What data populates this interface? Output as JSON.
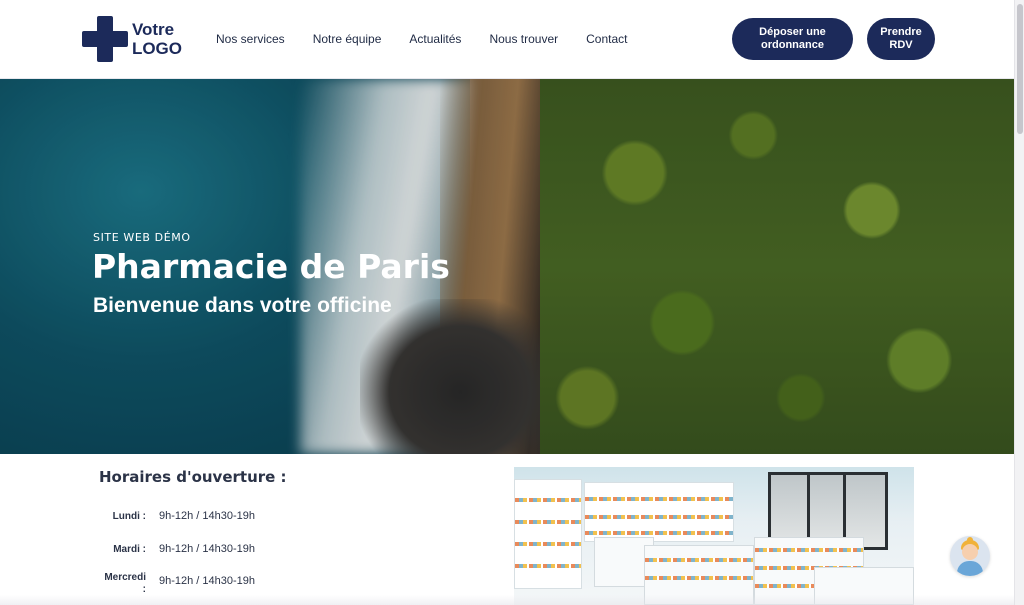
{
  "header": {
    "logo": {
      "line1": "Votre",
      "line2": "LOGO"
    },
    "nav": [
      {
        "label": "Nos services"
      },
      {
        "label": "Notre équipe"
      },
      {
        "label": "Actualités"
      },
      {
        "label": "Nous trouver"
      },
      {
        "label": "Contact"
      }
    ],
    "buttons": {
      "ordonnance": "Déposer une ordonnance",
      "rdv": "Prendre RDV"
    }
  },
  "hero": {
    "kicker": "SITE WEB DÉMO",
    "title": "Pharmacie de Paris",
    "subtitle": "Bienvenue dans votre officine"
  },
  "hours": {
    "title": "Horaires d'ouverture :",
    "rows": [
      {
        "day": "Lundi :",
        "value": "9h-12h / 14h30-19h"
      },
      {
        "day": "Mardi :",
        "value": "9h-12h / 14h30-19h"
      },
      {
        "day": "Mercredi :",
        "value": "9h-12h / 14h30-19h"
      }
    ]
  },
  "colors": {
    "brand": "#1c2a5a",
    "text": "#1f2a44"
  }
}
